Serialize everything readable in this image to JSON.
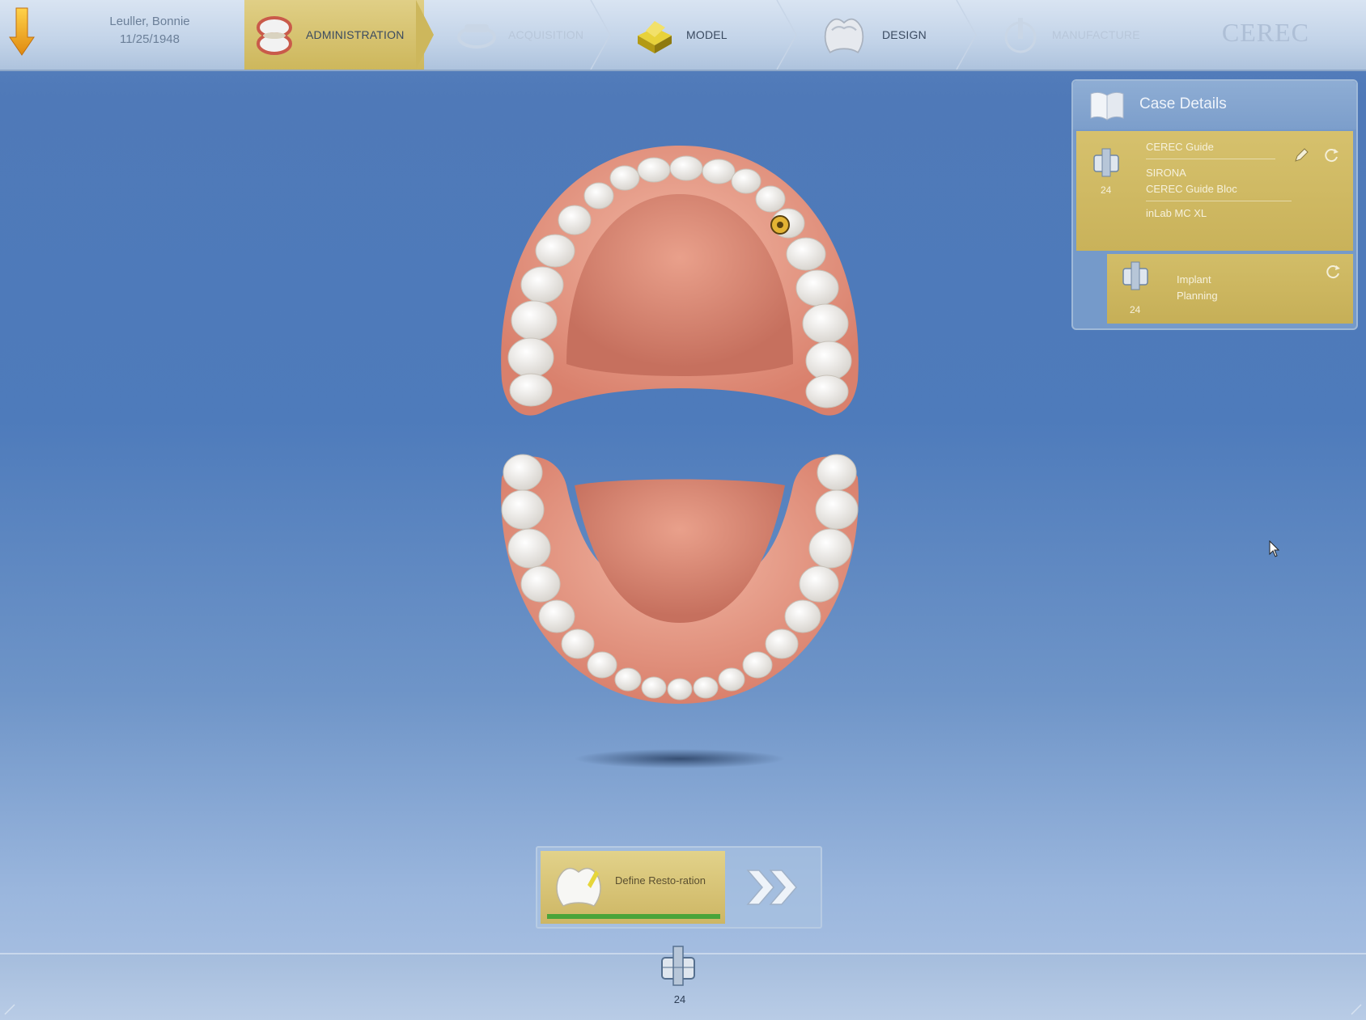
{
  "patient": {
    "name": "Leuller, Bonnie",
    "dob": "11/25/1948"
  },
  "steps": [
    {
      "label": "ADMINISTRATION",
      "state": "active"
    },
    {
      "label": "ACQUISITION",
      "state": "disabled"
    },
    {
      "label": "MODEL",
      "state": "enabled"
    },
    {
      "label": "DESIGN",
      "state": "enabled"
    },
    {
      "label": "MANUFACTURE",
      "state": "disabled"
    }
  ],
  "brand": "CEREC",
  "case_details": {
    "title": "Case Details",
    "items": [
      {
        "tooth": "24",
        "lines": [
          "CEREC Guide",
          "SIRONA",
          "CEREC Guide Bloc",
          "inLab MC XL"
        ]
      },
      {
        "tooth": "24",
        "lines": [
          "Implant",
          "Planning"
        ]
      }
    ]
  },
  "define_restoration": {
    "label": "Define Resto-ration",
    "progress": 1.0
  },
  "bottom": {
    "tooth": "24"
  },
  "colors": {
    "accent_gold": "#cdb664",
    "background_blue": "#4e7bbb",
    "progress_green": "#4aa43a"
  }
}
